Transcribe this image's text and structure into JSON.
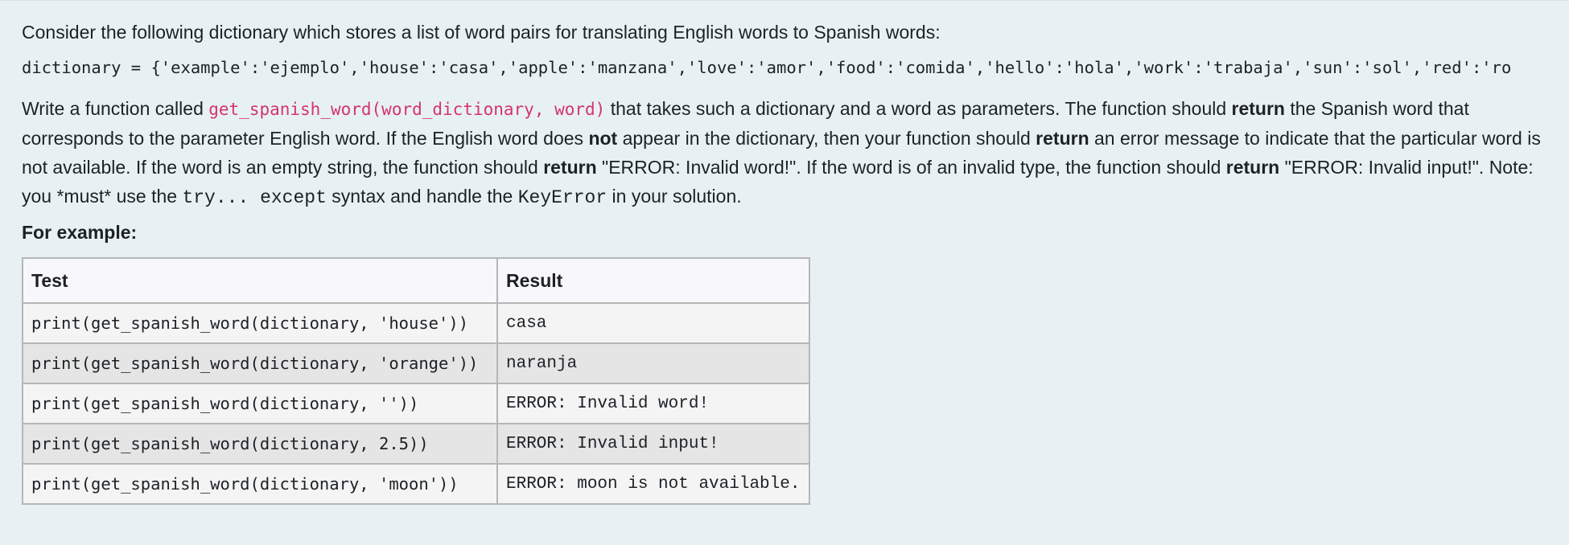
{
  "question": {
    "intro": "Consider the following dictionary which stores a list of word pairs for translating English words to Spanish words:",
    "dictionary_line": "dictionary = {'example':'ejemplo','house':'casa','apple':'manzana','love':'amor','food':'comida','hello':'hola','work':'trabaja','sun':'sol','red':'ro",
    "desc": {
      "p1": "Write a function called ",
      "fn_name": "get_spanish_word(word_dictionary, word)",
      "p2": " that takes such a dictionary and a word as parameters. The function should ",
      "b1": "return",
      "p3": " the Spanish word that corresponds to the parameter English word. If the English word does ",
      "b2": "not",
      "p4": " appear in the dictionary, then your function should ",
      "b3": "return",
      "p5": " an error message to indicate that the particular word is not available. If the word is an empty string, the function should ",
      "b4": "return",
      "p6": " \"ERROR: Invalid word!\". If the word is of an invalid type, the function should ",
      "b5": "return",
      "p7": " \"ERROR: Invalid input!\". Note: you *must* use the ",
      "code1": "try... except",
      "p8": " syntax and handle the ",
      "code2": "KeyError",
      "p9": " in your solution."
    },
    "for_example": "For example:"
  },
  "examples_table": {
    "headers": [
      "Test",
      "Result"
    ],
    "rows": [
      {
        "test": "print(get_spanish_word(dictionary, 'house'))",
        "result": "casa"
      },
      {
        "test": "print(get_spanish_word(dictionary, 'orange'))",
        "result": "naranja"
      },
      {
        "test": "print(get_spanish_word(dictionary, ''))",
        "result": "ERROR: Invalid word!"
      },
      {
        "test": "print(get_spanish_word(dictionary, 2.5))",
        "result": "ERROR: Invalid input!"
      },
      {
        "test": "print(get_spanish_word(dictionary, 'moon'))",
        "result": "ERROR: moon is not available."
      }
    ]
  },
  "colors": {
    "background": "#e7f1f4",
    "function_name": "#d6336c",
    "table_border": "#b6b6b6",
    "row_light": "#f4f4f4",
    "row_dark": "#e5e5e5"
  }
}
